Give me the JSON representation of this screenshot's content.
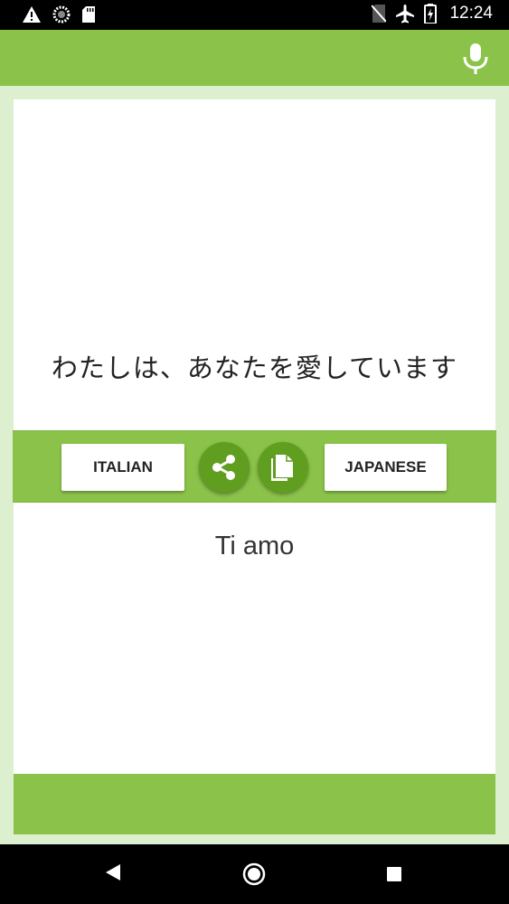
{
  "status_bar": {
    "time": "12:24",
    "icons_left": [
      "warning-icon",
      "loading-icon",
      "sd-card-icon"
    ],
    "icons_right": [
      "no-sim-icon",
      "airplane-mode-icon",
      "battery-charging-icon"
    ]
  },
  "toolbar": {
    "mic_icon": "microphone-icon"
  },
  "source": {
    "text": "わたしは、あなたを愛しています"
  },
  "actions": {
    "source_language": "ITALIAN",
    "target_language": "JAPANESE",
    "share_icon": "share-icon",
    "copy_icon": "copy-icon"
  },
  "translation": {
    "text": "Ti amo"
  },
  "colors": {
    "primary": "#8bc34a",
    "accent": "#5f9e1f",
    "background": "#dcefcf"
  },
  "nav_bar": {
    "icons": [
      "back-icon",
      "home-icon",
      "recents-icon"
    ]
  }
}
